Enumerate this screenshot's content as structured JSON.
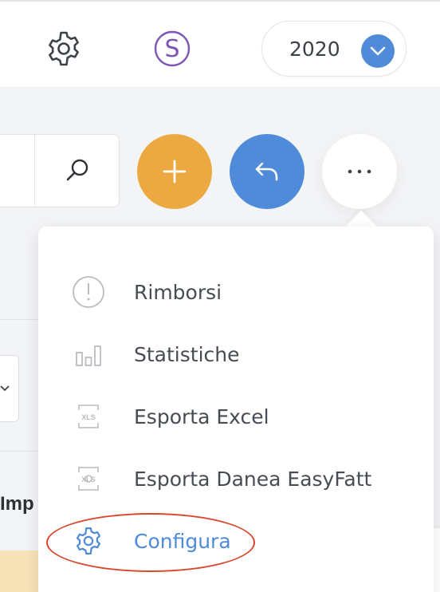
{
  "header": {
    "settings_icon": "gear-icon",
    "profile_initial": "S",
    "year_selector": {
      "value": "2020",
      "chevron_icon": "chevron-down-icon"
    }
  },
  "toolbar": {
    "search_icon": "search-icon",
    "add_icon": "plus-icon",
    "back_icon": "reply-icon",
    "more_icon": "ellipsis-icon"
  },
  "background": {
    "column_header_partial": "Imp"
  },
  "menu": {
    "items": [
      {
        "label": "Rimborsi",
        "icon": "alert-circle-icon"
      },
      {
        "label": "Statistiche",
        "icon": "bar-chart-icon"
      },
      {
        "label": "Esporta Excel",
        "icon": "xls-file-icon"
      },
      {
        "label": "Esporta Danea EasyFatt",
        "icon": "xls-export-icon"
      },
      {
        "label": "Configura",
        "icon": "gear-icon",
        "active": true
      }
    ]
  },
  "colors": {
    "accent_blue": "#4f8bd8",
    "accent_orange": "#eda941",
    "highlight_red": "#d9452a",
    "purple": "#7c55b5"
  }
}
